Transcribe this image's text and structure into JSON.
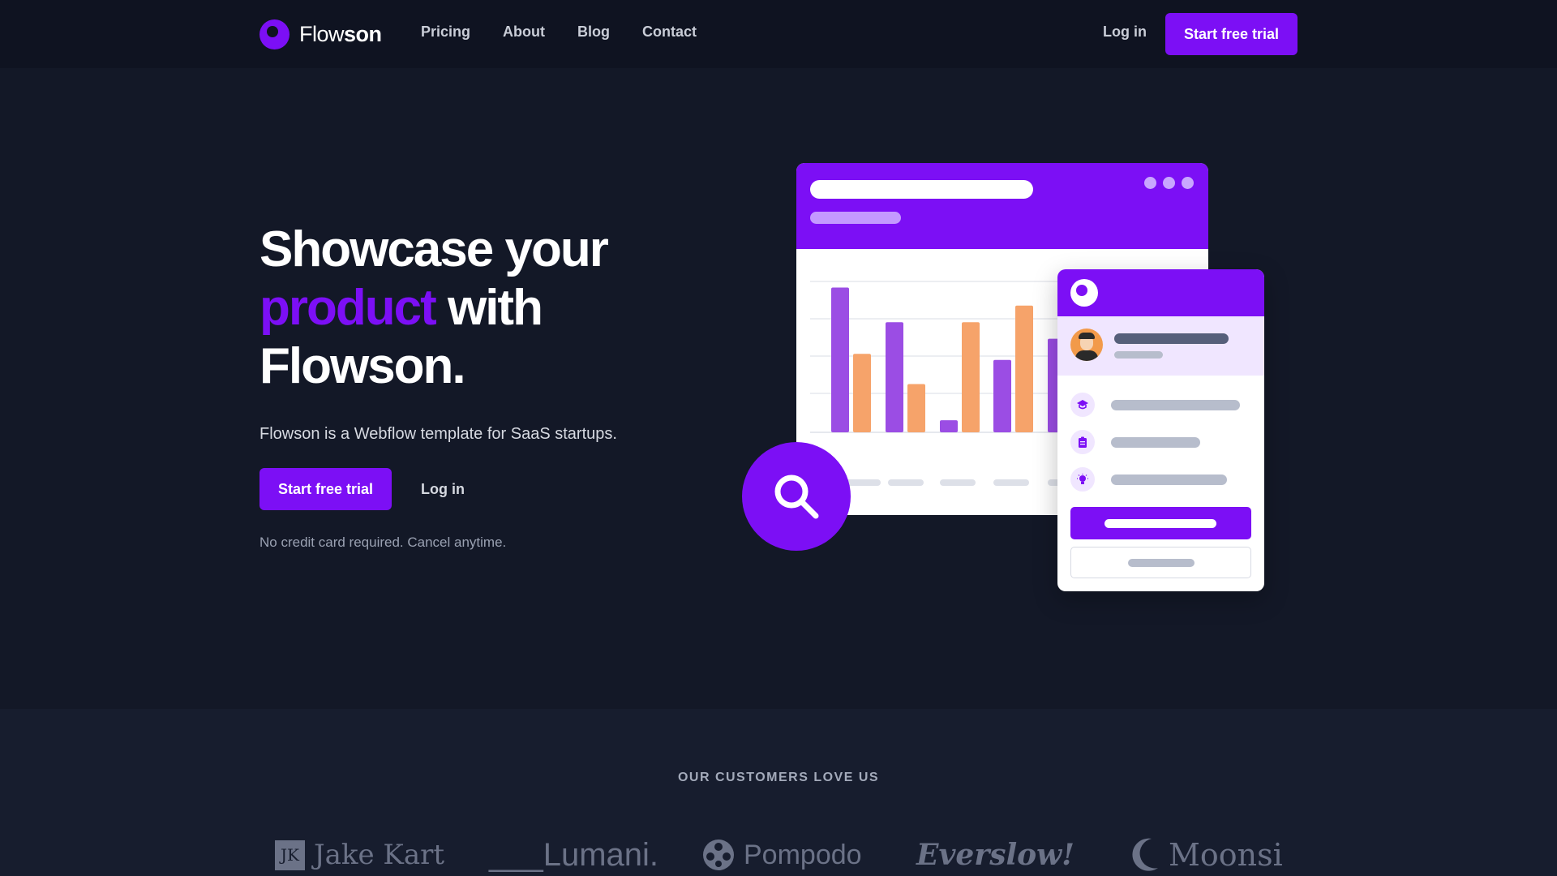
{
  "nav": {
    "brand_part1": "Flow",
    "brand_part2": "son",
    "links": [
      "Pricing",
      "About",
      "Blog",
      "Contact"
    ],
    "login": "Log in",
    "cta": "Start free trial"
  },
  "hero": {
    "title_line1": "Showcase your",
    "title_accent": "product",
    "title_with": " with",
    "title_line3": "Flowson.",
    "subtitle": "Flowson is a Webflow template for SaaS startups.",
    "cta": "Start free trial",
    "login": "Log in",
    "note": "No credit card required. Cancel anytime."
  },
  "illustration": {
    "bars_purple": [
      0.96,
      0.73,
      0.08,
      0.48,
      0.62
    ],
    "bars_orange": [
      0.52,
      0.32,
      0.73,
      0.84
    ],
    "colors": {
      "purple": "#9b4de4",
      "orange": "#f6a36a",
      "accent": "#7c0ff5"
    }
  },
  "customers": {
    "heading": "OUR CUSTOMERS LOVE US",
    "logos": {
      "jake_kart_mark": "JK",
      "jake_kart": "Jake Kart",
      "lumani": "___Lumani.",
      "pompodo": "Pompodo",
      "everslow": "Everslow!",
      "moonsi": "Moonsi"
    }
  },
  "icons": [
    "logo-icon",
    "search-icon",
    "graduation-cap-icon",
    "clipboard-icon",
    "lightbulb-icon",
    "pompodo-film-icon",
    "moon-icon"
  ]
}
